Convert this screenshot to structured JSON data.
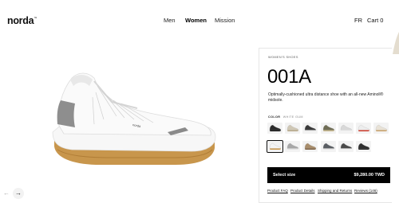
{
  "header": {
    "logo": "norda",
    "logo_mark": "™",
    "nav": [
      "Men",
      "Women",
      "Mission"
    ],
    "active_nav": "Women",
    "language": "FR",
    "cart_label": "Cart",
    "cart_count": "0"
  },
  "gallery": {
    "prev_icon": "←",
    "next_icon": "→"
  },
  "product": {
    "eyebrow": "WOMEN'S SHOES",
    "name": "001A",
    "description": "Optimally-cushioned ultra distance shoe with an all-new Aminoll® midsole.",
    "color_label": "COLOR",
    "color_value": "WHITE GUM",
    "swatches": [
      {
        "name": "black",
        "color": "#2b2b2b",
        "sole": "#1a1a1a"
      },
      {
        "name": "sand",
        "color": "#cfc7b5",
        "sole": "#b9a98a"
      },
      {
        "name": "grey-black",
        "color": "#3a3a3a",
        "sole": "#e9e9e9"
      },
      {
        "name": "olive",
        "color": "#6f6d55",
        "sole": "#c9b98e"
      },
      {
        "name": "light-grey",
        "color": "#d8d8d8",
        "sole": "#f2f2f2"
      },
      {
        "name": "white-red",
        "color": "#ededed",
        "sole": "#cf3d2e"
      },
      {
        "name": "cream",
        "color": "#e8e2d6",
        "sole": "#caa26a"
      },
      {
        "name": "white-gum",
        "color": "#f4f4f4",
        "sole": "#c79447"
      },
      {
        "name": "grey",
        "color": "#a7a7a7",
        "sole": "#e3e3e3"
      },
      {
        "name": "tan",
        "color": "#a88d6b",
        "sole": "#7d6245"
      },
      {
        "name": "slate",
        "color": "#5a5e63",
        "sole": "#e5e5e5"
      },
      {
        "name": "charcoal",
        "color": "#4a4a4a",
        "sole": "#f0f0f0"
      },
      {
        "name": "dark",
        "color": "#2f2f2f",
        "sole": "#242424"
      }
    ],
    "selected_swatch": 7,
    "select_label": "Select size",
    "price": "$9,280.00 TWD",
    "links": [
      "Product FAQ",
      "Product Details",
      "Shipping and Returns",
      "Reviews (146)"
    ]
  }
}
